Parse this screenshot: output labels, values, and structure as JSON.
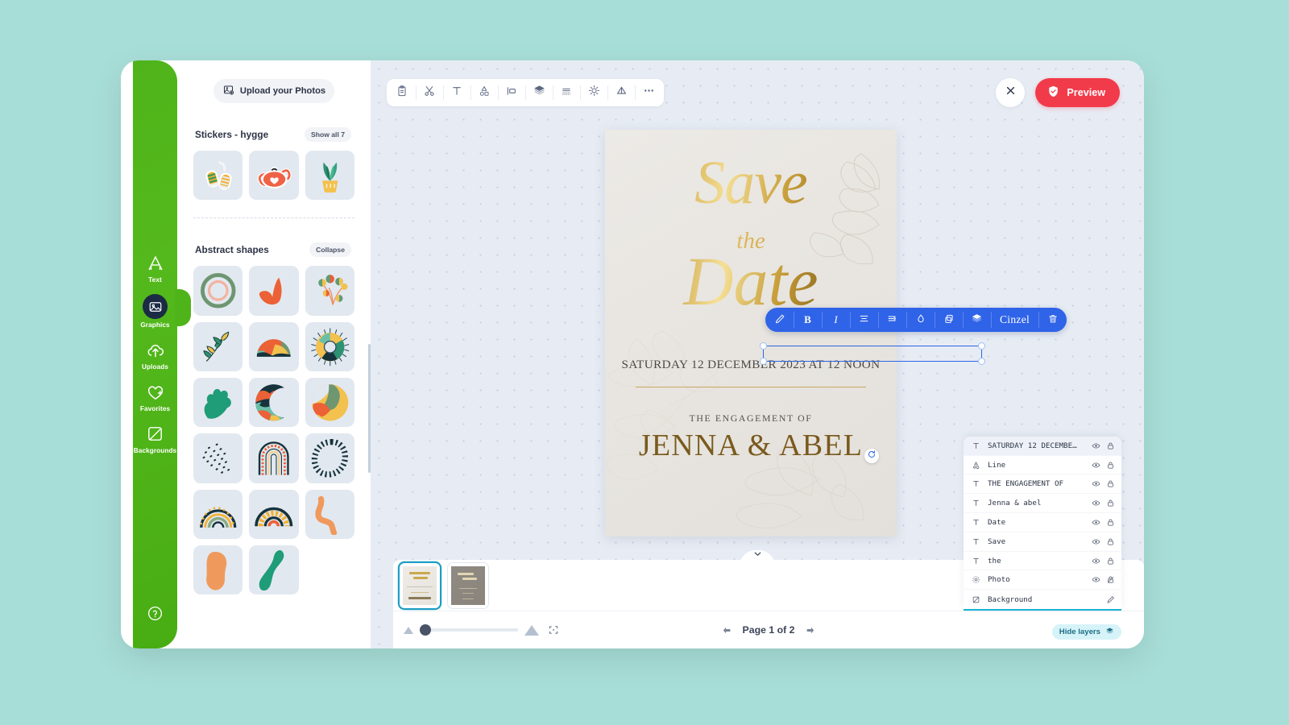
{
  "app": {
    "background_color": "#a8ded8",
    "accent_blue": "#2f63e8",
    "accent_red": "#f23b4a",
    "accent_green": "#4fb41a",
    "accent_teal": "#18b4d4"
  },
  "rail": {
    "items": [
      {
        "label": "Text",
        "icon": "text-a-icon",
        "active": false
      },
      {
        "label": "Graphics",
        "icon": "image-icon",
        "active": true
      },
      {
        "label": "Uploads",
        "icon": "cloud-upload-icon",
        "active": false
      },
      {
        "label": "Favorites",
        "icon": "heart-plus-icon",
        "active": false
      },
      {
        "label": "Backgrounds",
        "icon": "background-square-icon",
        "active": false
      }
    ],
    "help_icon": "question-circle-icon"
  },
  "assets": {
    "upload_button": "Upload your Photos",
    "upload_icon": "image-add-icon",
    "sections": [
      {
        "title": "Stickers - hygge",
        "action": "Show all 7",
        "items": [
          "mittens-sticker",
          "teapot-sticker",
          "potted-plant-sticker"
        ]
      },
      {
        "title": "Abstract shapes",
        "action": "Collapse",
        "items": [
          "concentric-rings-shape",
          "orange-bird-shape",
          "balloon-branch-shape",
          "olive-branch-shape",
          "half-dome-landscape-shape",
          "sunburst-ring-shape",
          "teal-hand-leaf-shape",
          "crescent-collage-shape",
          "moon-wedge-shape",
          "dot-scatter-shape",
          "arch-rainbow-shape",
          "dashed-loop-shape",
          "green-rainbow-shape",
          "orange-rainbow-shape",
          "orange-squiggle-shape",
          "orange-blob-shape",
          "teal-blob-shape"
        ]
      }
    ]
  },
  "toolbar": {
    "buttons": [
      {
        "name": "clipboard",
        "icon": "clipboard-icon"
      },
      {
        "name": "cut",
        "icon": "scissors-icon"
      },
      {
        "name": "text",
        "icon": "text-t-icon"
      },
      {
        "name": "shapes",
        "icon": "shapes-icon"
      },
      {
        "name": "align",
        "icon": "align-left-icon"
      },
      {
        "name": "layers",
        "icon": "layers-icon"
      },
      {
        "name": "grid",
        "icon": "grid-lines-icon"
      },
      {
        "name": "brightness",
        "icon": "brightness-icon"
      },
      {
        "name": "filter",
        "icon": "triangle-filter-icon"
      },
      {
        "name": "more",
        "icon": "ellipsis-icon"
      }
    ],
    "close_icon": "close-icon",
    "preview_label": "Preview",
    "preview_icon": "shield-check-icon"
  },
  "text_toolbar": {
    "buttons": [
      {
        "name": "edit",
        "icon": "pencil-icon",
        "label": ""
      },
      {
        "name": "bold",
        "icon": "bold-icon",
        "label": "B"
      },
      {
        "name": "italic",
        "icon": "italic-icon",
        "label": "I"
      },
      {
        "name": "align",
        "icon": "align-center-icon",
        "label": ""
      },
      {
        "name": "spacing",
        "icon": "letter-spacing-icon",
        "label": ""
      },
      {
        "name": "color",
        "icon": "droplet-icon",
        "label": ""
      },
      {
        "name": "duplicate",
        "icon": "copy-icon",
        "label": ""
      },
      {
        "name": "arrange",
        "icon": "layers-icon",
        "label": ""
      }
    ],
    "font_name": "Cinzel",
    "delete_icon": "trash-icon"
  },
  "design": {
    "title_line1": "Save",
    "title_line2": "the",
    "title_line3": "Date",
    "date_text": "SATURDAY 12 DECEMBER 2023 AT 12 NOON",
    "engagement_label": "THE ENGAGEMENT OF",
    "names": "JENNA & ABEL"
  },
  "pages": {
    "thumbnails": [
      {
        "name": "page-1",
        "selected": true
      },
      {
        "name": "page-2",
        "selected": false
      }
    ],
    "pager_text": "Page 1 of 2",
    "prev_icon": "arrow-left-icon",
    "next_icon": "arrow-right-icon",
    "collapse_icon": "chevron-down-icon"
  },
  "zoom": {
    "decrease_icon": "triangle-small-icon",
    "increase_icon": "triangle-large-icon",
    "fit_icon": "fit-screen-icon",
    "value_percent": 8
  },
  "layers": {
    "hide_label": "Hide layers",
    "hide_icon": "layers-icon",
    "rows": [
      {
        "name": "SATURDAY 12 DECEMBE…",
        "icon": "text-t-icon",
        "visible_icon": "eye-icon",
        "lock_icon": "lock-icon",
        "active": true
      },
      {
        "name": "Line",
        "icon": "shapes-icon",
        "visible_icon": "eye-icon",
        "lock_icon": "lock-icon",
        "active": false
      },
      {
        "name": "THE ENGAGEMENT OF",
        "icon": "text-t-icon",
        "visible_icon": "eye-icon",
        "lock_icon": "lock-icon",
        "active": false
      },
      {
        "name": "Jenna & abel",
        "icon": "text-t-icon",
        "visible_icon": "eye-icon",
        "lock_icon": "lock-icon",
        "active": false
      },
      {
        "name": "Date",
        "icon": "text-t-icon",
        "visible_icon": "eye-icon",
        "lock_icon": "lock-icon",
        "active": false
      },
      {
        "name": "Save",
        "icon": "text-t-icon",
        "visible_icon": "eye-icon",
        "lock_icon": "lock-icon",
        "active": false
      },
      {
        "name": "the",
        "icon": "text-t-icon",
        "visible_icon": "eye-icon",
        "lock_icon": "lock-icon",
        "active": false
      },
      {
        "name": "Photo",
        "icon": "photo-target-icon",
        "visible_icon": "eye-icon",
        "lock_icon": "lock-unlocked-icon",
        "active": false
      },
      {
        "name": "Background",
        "icon": "background-square-icon",
        "visible_icon": "",
        "lock_icon": "pencil-icon",
        "active": false
      }
    ]
  }
}
